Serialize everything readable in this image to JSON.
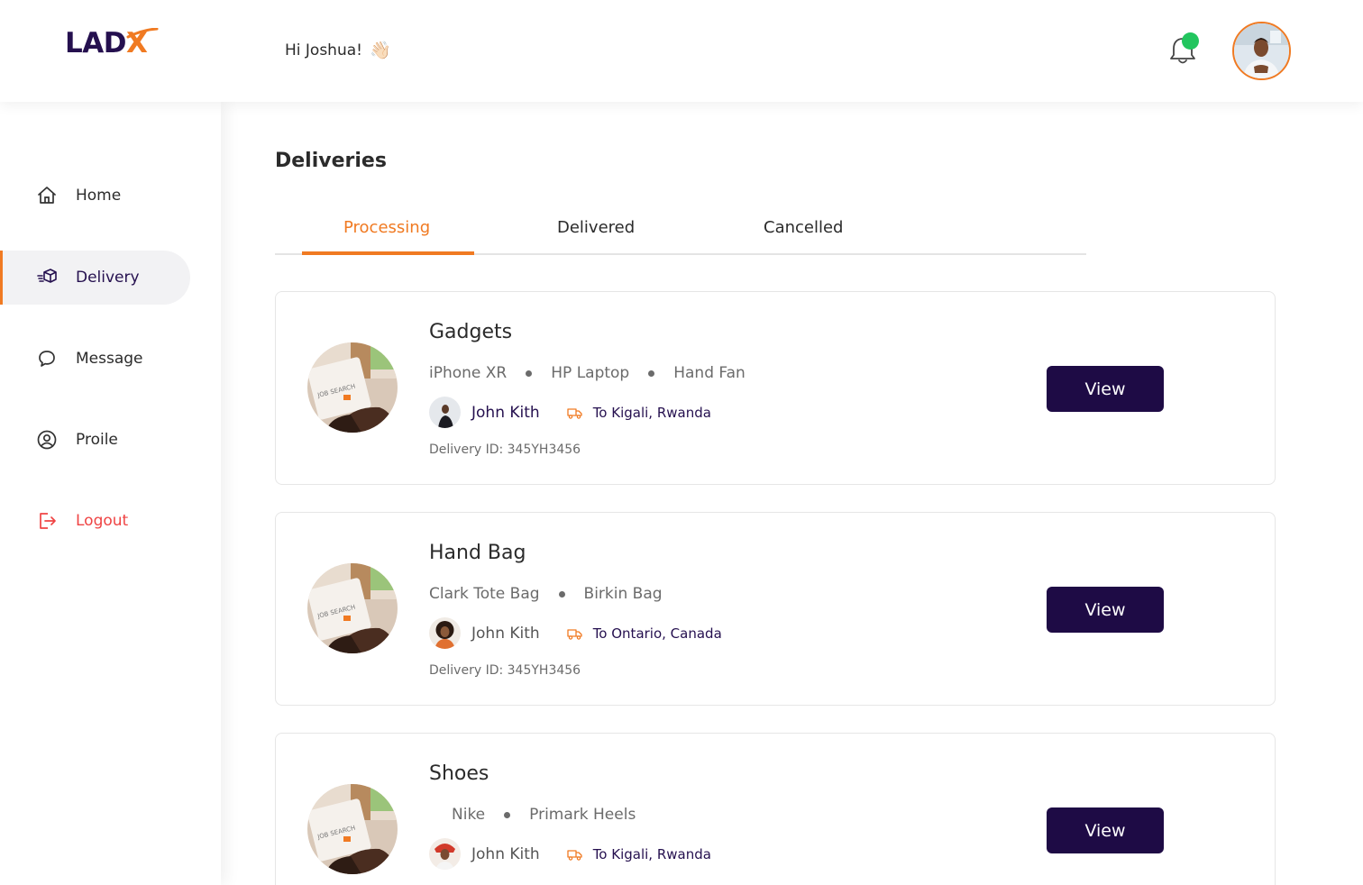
{
  "brand": {
    "logo_text": "LAD",
    "logo_accent": "X",
    "primary_color": "#25104f",
    "accent_color": "#f07a22"
  },
  "header": {
    "greeting": "Hi Joshua!",
    "greeting_emoji": "👋🏻",
    "notification_icon": "bell-icon",
    "has_notification": true
  },
  "sidebar": {
    "items": [
      {
        "label": "Home",
        "icon": "home-icon",
        "active": false
      },
      {
        "label": "Delivery",
        "icon": "package-icon",
        "active": true
      },
      {
        "label": "Message",
        "icon": "chat-bubble-icon",
        "active": false
      },
      {
        "label": "Proile",
        "icon": "user-circle-icon",
        "active": false
      },
      {
        "label": "Logout",
        "icon": "logout-icon",
        "active": false
      }
    ]
  },
  "main": {
    "title": "Deliveries",
    "tabs": [
      {
        "label": "Processing",
        "active": true
      },
      {
        "label": "Delivered",
        "active": false
      },
      {
        "label": "Cancelled",
        "active": false
      }
    ],
    "deliveries": [
      {
        "title": "Gadgets",
        "items": [
          "iPhone XR",
          "HP Laptop",
          "Hand Fan"
        ],
        "person": "John Kith",
        "destination": "To Kigali, Rwanda",
        "delivery_id": "Delivery ID: 345YH3456",
        "button": "View"
      },
      {
        "title": "Hand Bag",
        "items": [
          "Clark Tote Bag",
          "Birkin Bag"
        ],
        "person": "John Kith",
        "destination": "To Ontario, Canada",
        "delivery_id": "Delivery ID: 345YH3456",
        "button": "View"
      },
      {
        "title": "Shoes",
        "items": [
          "Nike",
          "Primark Heels"
        ],
        "person": "John Kith",
        "destination": "To Kigali, Rwanda",
        "delivery_id": "",
        "button": "View"
      }
    ]
  }
}
